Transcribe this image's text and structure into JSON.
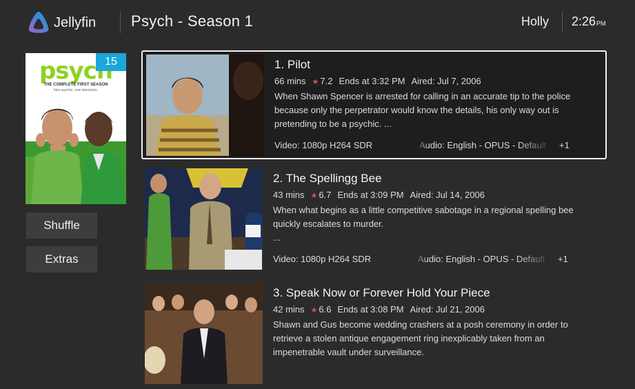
{
  "header": {
    "app_name": "Jellyfin",
    "page_title": "Psych - Season 1",
    "user_name": "Holly",
    "time": "2:26",
    "ampm": "PM"
  },
  "poster": {
    "badge": "15",
    "title": "psych",
    "subtitle": "THE COMPLETE FIRST SEASON",
    "tagline": "fake psychic. real detectives."
  },
  "side_buttons": {
    "shuffle": "Shuffle",
    "extras": "Extras"
  },
  "episodes": [
    {
      "title": "1. Pilot",
      "runtime": "66 mins",
      "rating": "7.2",
      "ends_at": "Ends at 3:32 PM",
      "aired": "Aired: Jul 7, 2006",
      "description": "When Shawn Spencer is arrested for calling in an accurate tip to the police because only the perpetrator would know the details, his only way out is pretending to be a psychic.  ...",
      "video": "Video: 1080p H264 SDR",
      "audio": "Audio: English - OPUS - Default - OP...",
      "extra": "+1"
    },
    {
      "title": "2. The Spellingg Bee",
      "runtime": "43 mins",
      "rating": "6.7",
      "ends_at": "Ends at 3:09 PM",
      "aired": "Aired: Jul 14, 2006",
      "description": "When what begins as a little competitive sabotage in a regional spelling bee quickly escalates to murder.\n ...",
      "video": "Video: 1080p H264 SDR",
      "audio": "Audio: English - OPUS - Default - OP...",
      "extra": "+1"
    },
    {
      "title": "3. Speak Now or Forever Hold Your Piece",
      "runtime": "42 mins",
      "rating": "6.6",
      "ends_at": "Ends at 3:08 PM",
      "aired": "Aired: Jul 21, 2006",
      "description": "Shawn and Gus become wedding crashers at a posh ceremony in order to retrieve a stolen antique engagement ring inexplicably taken from an impenetrable vault under surveillance.",
      "video": "",
      "audio": "",
      "extra": ""
    }
  ],
  "colors": {
    "accent": "#1aa7d9",
    "background": "#2b2b2b",
    "star": "#d9534f",
    "focus_border": "#f2f2f2"
  },
  "icons": {
    "logo": "jellyfin-logo-icon",
    "rating": "star-icon"
  }
}
